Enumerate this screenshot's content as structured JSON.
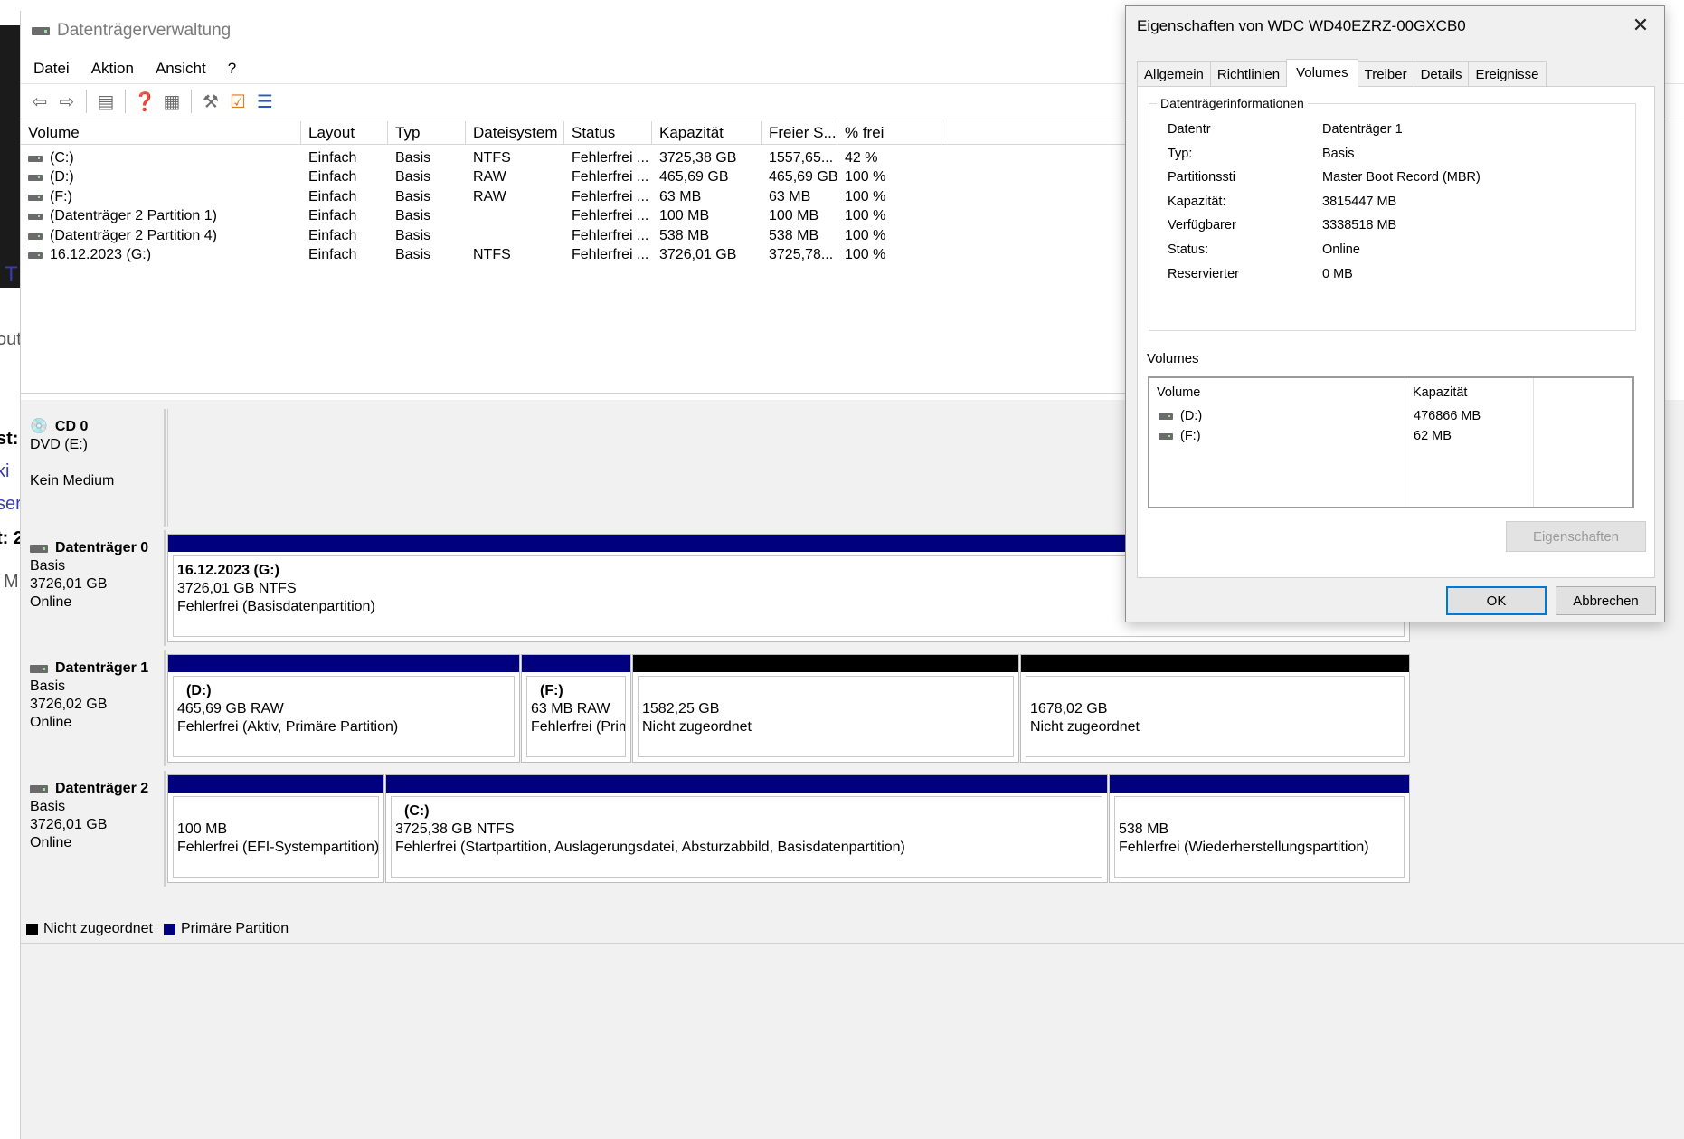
{
  "background_fragments": [
    "T",
    "out",
    "st:",
    "ki",
    "ser",
    "t: 2",
    "M"
  ],
  "window": {
    "title": "Datenträgerverwaltung"
  },
  "menu": [
    "Datei",
    "Aktion",
    "Ansicht",
    "?"
  ],
  "toolbar": {
    "icons": [
      "back-arrow-icon",
      "forward-arrow-icon",
      "console-tree-icon",
      "help-icon",
      "view-icon",
      "connect-icon",
      "check-icon",
      "properties-list-icon"
    ]
  },
  "volume_list": {
    "columns": [
      "Volume",
      "Layout",
      "Typ",
      "Dateisystem",
      "Status",
      "Kapazität",
      "Freier S...",
      "% frei"
    ],
    "rows": [
      [
        "(C:)",
        "Einfach",
        "Basis",
        "NTFS",
        "Fehlerfrei ...",
        "3725,38 GB",
        "1557,65...",
        "42 %"
      ],
      [
        "(D:)",
        "Einfach",
        "Basis",
        "RAW",
        "Fehlerfrei ...",
        "465,69 GB",
        "465,69 GB",
        "100 %"
      ],
      [
        "(F:)",
        "Einfach",
        "Basis",
        "RAW",
        "Fehlerfrei ...",
        "63 MB",
        "63 MB",
        "100 %"
      ],
      [
        "(Datenträger 2 Partition 1)",
        "Einfach",
        "Basis",
        "",
        "Fehlerfrei ...",
        "100 MB",
        "100 MB",
        "100 %"
      ],
      [
        "(Datenträger 2 Partition 4)",
        "Einfach",
        "Basis",
        "",
        "Fehlerfrei ...",
        "538 MB",
        "538 MB",
        "100 %"
      ],
      [
        "16.12.2023 (G:)",
        "Einfach",
        "Basis",
        "NTFS",
        "Fehlerfrei ...",
        "3726,01 GB",
        "3725,78...",
        "100 %"
      ]
    ]
  },
  "disks": {
    "cd0": {
      "name": "CD 0",
      "line1": "DVD (E:)",
      "line2": "Kein Medium"
    },
    "disk0": {
      "name": "Datenträger 0",
      "type": "Basis",
      "size": "3726,01 GB",
      "status": "Online",
      "parts": [
        {
          "name": "16.12.2023  (G:)",
          "size": "3726,01 GB NTFS",
          "status": "Fehlerfrei (Basisdatenpartition)"
        }
      ]
    },
    "disk1": {
      "name": "Datenträger 1",
      "type": "Basis",
      "size": "3726,02 GB",
      "status": "Online",
      "parts": [
        {
          "name": "(D:)",
          "size": "465,69 GB RAW",
          "status": "Fehlerfrei (Aktiv, Primäre Partition)"
        },
        {
          "name": "(F:)",
          "size": "63 MB RAW",
          "status": "Fehlerfrei (Prim"
        },
        {
          "name": "",
          "size": "1582,25 GB",
          "status": "Nicht zugeordnet"
        },
        {
          "name": "",
          "size": "1678,02 GB",
          "status": "Nicht zugeordnet"
        }
      ]
    },
    "disk2": {
      "name": "Datenträger 2",
      "type": "Basis",
      "size": "3726,01 GB",
      "status": "Online",
      "parts": [
        {
          "name": "",
          "size": "100 MB",
          "status": "Fehlerfrei (EFI-Systempartition)"
        },
        {
          "name": "(C:)",
          "size": "3725,38 GB NTFS",
          "status": "Fehlerfrei (Startpartition, Auslagerungsdatei, Absturzabbild, Basisdatenpartition)"
        },
        {
          "name": "",
          "size": "538 MB",
          "status": "Fehlerfrei (Wiederherstellungspartition)"
        }
      ]
    }
  },
  "legend": {
    "unallocated": "Nicht zugeordnet",
    "primary": "Primäre Partition"
  },
  "colors": {
    "primary": "#00007f",
    "unallocated": "#000000",
    "accent": "#0078d7"
  },
  "dialog": {
    "title": "Eigenschaften von WDC WD40EZRZ-00GXCB0",
    "tabs": [
      "Allgemein",
      "Richtlinien",
      "Volumes",
      "Treiber",
      "Details",
      "Ereignisse"
    ],
    "active_tab": "Volumes",
    "info_group_title": "Datenträgerinformationen",
    "info": [
      {
        "key": "Datentr",
        "value": "Datenträger 1"
      },
      {
        "key": "Typ:",
        "value": "Basis"
      },
      {
        "key": "Partitionssti",
        "value": "Master Boot Record (MBR)"
      },
      {
        "key": "Kapazität:",
        "value": "3815447 MB"
      },
      {
        "key": "Verfügbarer",
        "value": "3338518 MB"
      },
      {
        "key": "Status:",
        "value": "Online"
      },
      {
        "key": "Reservierter",
        "value": "0 MB"
      }
    ],
    "volumes_caption": "Volumes",
    "volumes_columns": [
      "Volume",
      "Kapazität"
    ],
    "volumes": [
      {
        "name": "(D:)",
        "capacity": "476866 MB"
      },
      {
        "name": "(F:)",
        "capacity": "62 MB"
      }
    ],
    "properties_button": "Eigenschaften",
    "ok_button": "OK",
    "cancel_button": "Abbrechen"
  }
}
